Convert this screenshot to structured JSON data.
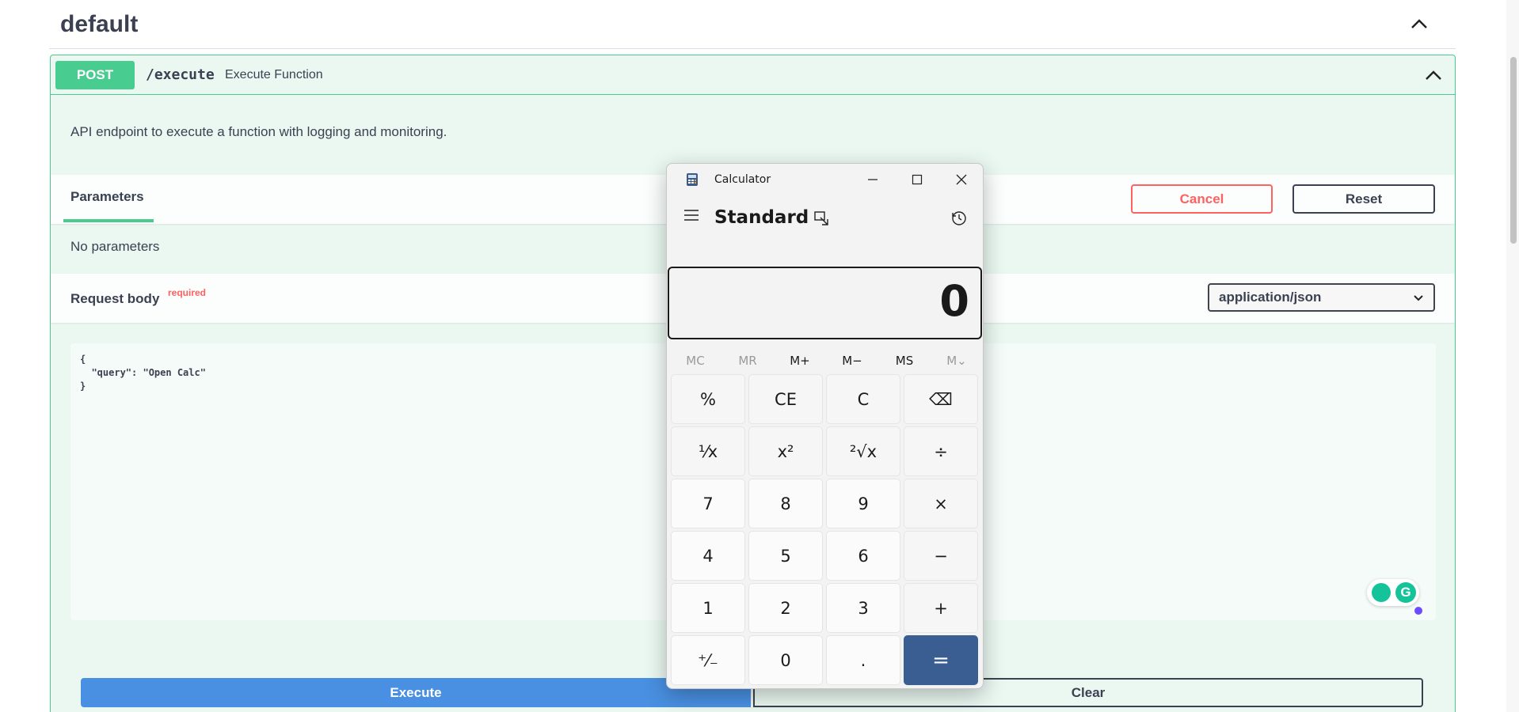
{
  "tag": {
    "title": "default"
  },
  "operation": {
    "method": "POST",
    "path": "/execute",
    "summary": "Execute Function",
    "description": "API endpoint to execute a function with logging and monitoring."
  },
  "parameters": {
    "tab_label": "Parameters",
    "cancel_label": "Cancel",
    "reset_label": "Reset",
    "empty_text": "No parameters"
  },
  "request_body": {
    "label": "Request body",
    "required_tag": "required",
    "content_type": "application/json",
    "value": "{\n  \"query\": \"Open Calc\"\n}"
  },
  "actions": {
    "execute_label": "Execute",
    "clear_label": "Clear"
  },
  "calculator": {
    "title": "Calculator",
    "mode": "Standard",
    "display": "0",
    "memory": [
      "MC",
      "MR",
      "M+",
      "M−",
      "MS",
      "M⌄"
    ],
    "keys": [
      [
        "%",
        "CE",
        "C",
        "⌫"
      ],
      [
        "¹⁄x",
        "x²",
        "²√x",
        "÷"
      ],
      [
        "7",
        "8",
        "9",
        "×"
      ],
      [
        "4",
        "5",
        "6",
        "−"
      ],
      [
        "1",
        "2",
        "3",
        "+"
      ],
      [
        "⁺⁄₋",
        "0",
        ".",
        "="
      ]
    ]
  },
  "colors": {
    "post_accent": "#49cc90",
    "execute_blue": "#4990e2",
    "cancel_red": "#ff6060",
    "equals_blue": "#3a5e92"
  }
}
